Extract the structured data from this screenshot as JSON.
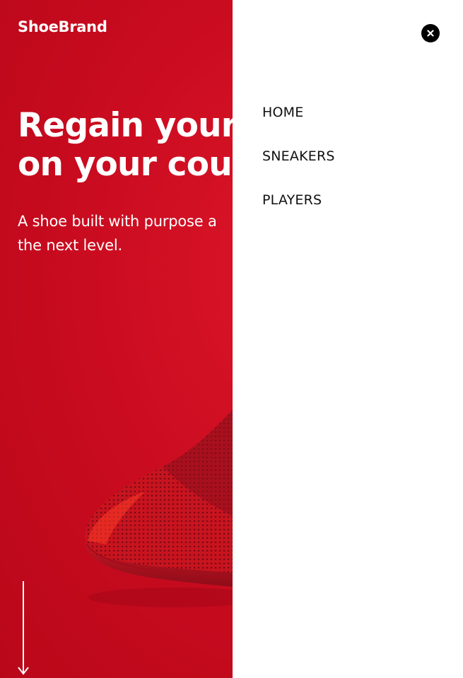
{
  "brand": {
    "name": "ShoeBrand"
  },
  "hero": {
    "headline_line1": "Regain your",
    "headline_line2": "on your cour",
    "subtext_line1": "A shoe built with purpose a",
    "subtext_line2": "the next level."
  },
  "menu": {
    "items": [
      {
        "label": "HOME"
      },
      {
        "label": "SNEAKERS"
      },
      {
        "label": "PLAYERS"
      }
    ],
    "close_icon": "close-icon"
  },
  "colors": {
    "hero_red": "#c80b1f",
    "shoe_red": "#d01420",
    "panel_bg": "#ffffff",
    "menu_text": "#111111",
    "close_bg": "#000000"
  },
  "icons": {
    "scroll": "arrow-down-icon"
  }
}
